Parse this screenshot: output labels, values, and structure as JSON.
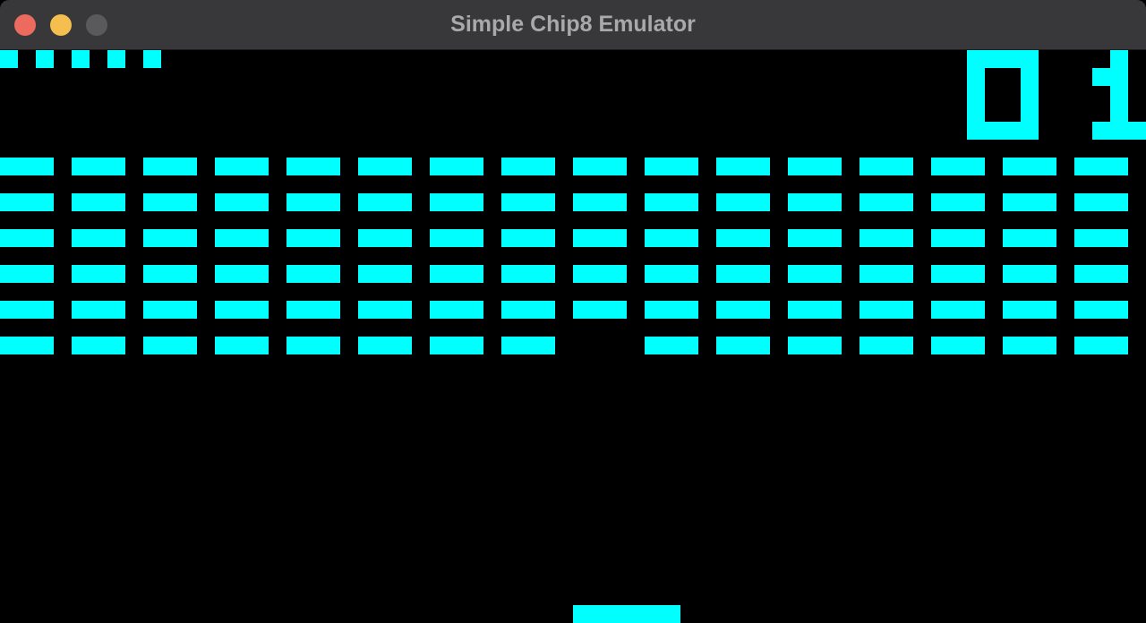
{
  "window": {
    "title": "Simple Chip8 Emulator",
    "buttons": {
      "close": "close-button",
      "minimize": "minimize-button",
      "zoom": "zoom-button"
    },
    "colors": {
      "titlebar": "#38383a",
      "title_text": "#a9a9ab",
      "close": "#ec6a5e",
      "minimize": "#f4bf4f",
      "zoom_inactive": "#5a5a5c"
    }
  },
  "emulator": {
    "display_columns": 64,
    "display_rows": 32,
    "foreground_color": "#00ffff",
    "background_color": "#000000",
    "game": {
      "lives_remaining": 5,
      "score": "01",
      "brick_columns": 16,
      "brick_rows": 6,
      "missing_bricks": [
        {
          "row": 5,
          "column": 8
        }
      ]
    }
  }
}
